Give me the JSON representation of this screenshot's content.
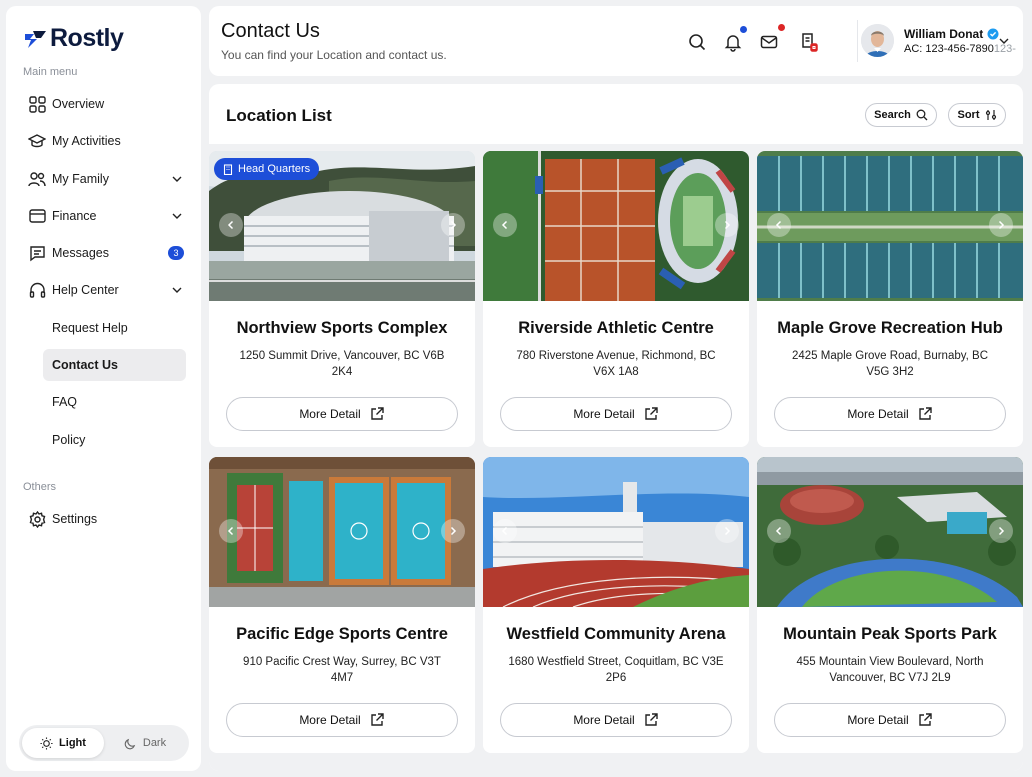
{
  "brand": {
    "name": "Rostly",
    "accent": "#1d4ed8"
  },
  "sidebar": {
    "main_menu_label": "Main menu",
    "others_label": "Others",
    "items": [
      {
        "label": "Overview",
        "icon": "grid-icon"
      },
      {
        "label": "My Activities",
        "icon": "graduation-cap-icon"
      },
      {
        "label": "My Family",
        "icon": "users-icon"
      },
      {
        "label": "Finance",
        "icon": "credit-card-icon"
      },
      {
        "label": "Messages",
        "icon": "message-icon",
        "badge": "3"
      },
      {
        "label": "Help Center",
        "icon": "headset-icon"
      }
    ],
    "sub_items": [
      {
        "label": "Request Help"
      },
      {
        "label": "Contact Us"
      },
      {
        "label": "FAQ"
      },
      {
        "label": "Policy"
      }
    ],
    "settings_label": "Settings",
    "theme": {
      "light": "Light",
      "dark": "Dark"
    }
  },
  "header": {
    "title": "Contact Us",
    "subtitle": "You can find your Location and contact us.",
    "user": {
      "name": "William Donat",
      "account": "AC: 123-456-7890",
      "account_fade": "123-"
    }
  },
  "main": {
    "title": "Location List",
    "search_label": "Search",
    "sort_label": "Sort",
    "hq_label": "Head Quarters",
    "more_label": "More Detail",
    "locations": [
      {
        "name": "Northview Sports Complex",
        "address": "1250 Summit Drive, Vancouver, BC V6B 2K4"
      },
      {
        "name": "Riverside Athletic Centre",
        "address": "780 Riverstone Avenue, Richmond, BC V6X 1A8"
      },
      {
        "name": "Maple Grove Recreation Hub",
        "address": "2425 Maple Grove Road, Burnaby, BC V5G 3H2"
      },
      {
        "name": "Pacific Edge Sports Centre",
        "address": "910 Pacific Crest Way, Surrey, BC V3T 4M7"
      },
      {
        "name": "Westfield Community Arena",
        "address": "1680 Westfield Street, Coquitlam, BC V3E 2P6"
      },
      {
        "name": "Mountain Peak Sports Park",
        "address": "455 Mountain View Boulevard, North Vancouver, BC V7J 2L9"
      }
    ]
  }
}
